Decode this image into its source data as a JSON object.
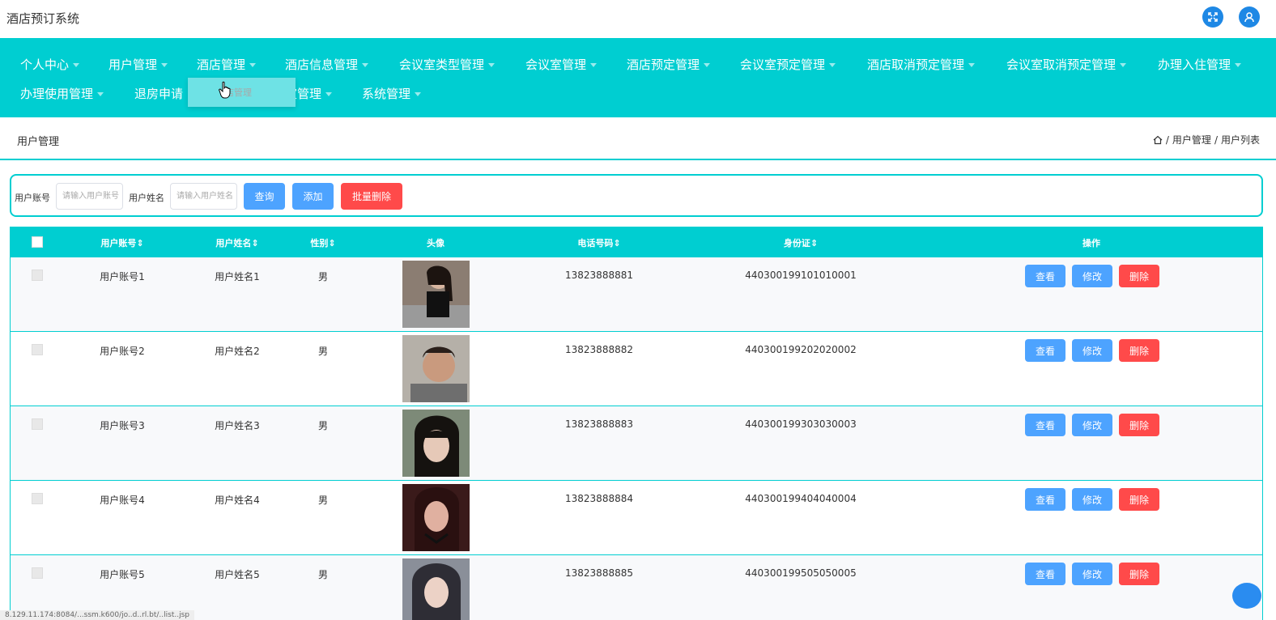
{
  "app": {
    "title": "酒店预订系统"
  },
  "nav": {
    "items": [
      {
        "label": "个人中心"
      },
      {
        "label": "用户管理"
      },
      {
        "label": "酒店管理"
      },
      {
        "label": "酒店信息管理"
      },
      {
        "label": "会议室类型管理"
      },
      {
        "label": "会议室管理"
      },
      {
        "label": "酒店预定管理"
      },
      {
        "label": "会议室预定管理"
      },
      {
        "label": "酒店取消预定管理"
      },
      {
        "label": "会议室取消预定管理"
      },
      {
        "label": "办理入住管理"
      },
      {
        "label": "办理使用管理"
      },
      {
        "label": "退房申请"
      },
      {
        "label": "室管理"
      },
      {
        "label": "系统管理"
      }
    ],
    "dropdown_item": "店管理"
  },
  "breadcrumb": {
    "title": "用户管理",
    "path1": "用户管理",
    "path2": "用户列表",
    "sep": "/"
  },
  "search": {
    "account_label": "用户账号",
    "account_placeholder": "请输入用户账号",
    "name_label": "用户姓名",
    "name_placeholder": "请输入用户姓名",
    "query_btn": "查询",
    "add_btn": "添加",
    "batch_delete_btn": "批量删除"
  },
  "table": {
    "headers": {
      "account": "用户账号",
      "name": "用户姓名",
      "gender": "性别",
      "avatar": "头像",
      "phone": "电话号码",
      "idcard": "身份证",
      "ops": "操作"
    },
    "rows": [
      {
        "account": "用户账号1",
        "name": "用户姓名1",
        "gender": "男",
        "phone": "13823888881",
        "idcard": "440300199101010001"
      },
      {
        "account": "用户账号2",
        "name": "用户姓名2",
        "gender": "男",
        "phone": "13823888882",
        "idcard": "440300199202020002"
      },
      {
        "account": "用户账号3",
        "name": "用户姓名3",
        "gender": "男",
        "phone": "13823888883",
        "idcard": "440300199303030003"
      },
      {
        "account": "用户账号4",
        "name": "用户姓名4",
        "gender": "男",
        "phone": "13823888884",
        "idcard": "440300199404040004"
      },
      {
        "account": "用户账号5",
        "name": "用户姓名5",
        "gender": "男",
        "phone": "13823888885",
        "idcard": "440300199505050005"
      }
    ],
    "actions": {
      "view": "查看",
      "edit": "修改",
      "delete": "删除"
    }
  },
  "status_url": "8.129.11.174:8084/...ssm.k600/jo..d..rl.bt/..list..jsp",
  "colors": {
    "primary": "#00ced1",
    "blue": "#4da3ff",
    "red": "#ff4a4a"
  }
}
